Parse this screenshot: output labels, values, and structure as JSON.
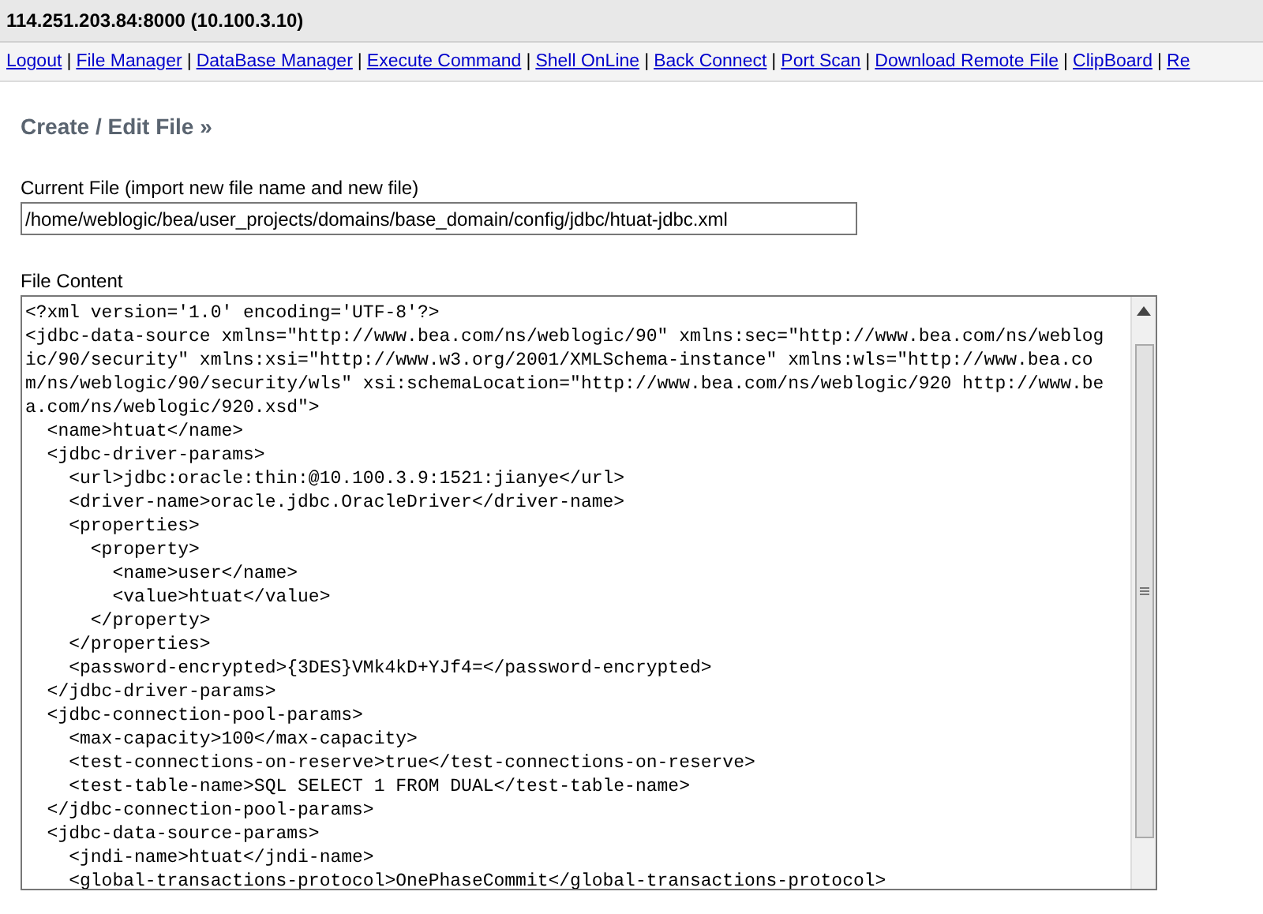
{
  "header": {
    "title": "114.251.203.84:8000 (10.100.3.10)"
  },
  "nav": {
    "separator": "|",
    "links": [
      "Logout",
      "File Manager",
      "DataBase Manager",
      "Execute Command",
      "Shell OnLine",
      "Back Connect",
      "Port Scan",
      "Download Remote File",
      "ClipBoard",
      "Re"
    ]
  },
  "section_title": "Create / Edit File »",
  "current_file": {
    "label": "Current File (import new file name and new file)",
    "value": "/home/weblogic/bea/user_projects/domains/base_domain/config/jdbc/htuat-jdbc.xml"
  },
  "file_content": {
    "label": "File Content",
    "lines": [
      "<?xml version='1.0' encoding='UTF-8'?>",
      "<jdbc-data-source xmlns=\"http://www.bea.com/ns/weblogic/90\" xmlns:sec=\"http://www.bea.com/ns/weblog",
      "ic/90/security\" xmlns:xsi=\"http://www.w3.org/2001/XMLSchema-instance\" xmlns:wls=\"http://www.bea.co",
      "m/ns/weblogic/90/security/wls\" xsi:schemaLocation=\"http://www.bea.com/ns/weblogic/920 http://www.be",
      "a.com/ns/weblogic/920.xsd\">",
      "  <name>htuat</name>",
      "  <jdbc-driver-params>",
      "    <url>jdbc:oracle:thin:@10.100.3.9:1521:jianye</url>",
      "    <driver-name>oracle.jdbc.OracleDriver</driver-name>",
      "    <properties>",
      "      <property>",
      "        <name>user</name>",
      "        <value>htuat</value>",
      "      </property>",
      "    </properties>",
      "    <password-encrypted>{3DES}VMk4kD+YJf4=</password-encrypted>",
      "  </jdbc-driver-params>",
      "  <jdbc-connection-pool-params>",
      "    <max-capacity>100</max-capacity>",
      "    <test-connections-on-reserve>true</test-connections-on-reserve>",
      "    <test-table-name>SQL SELECT 1 FROM DUAL</test-table-name>",
      "  </jdbc-connection-pool-params>",
      "  <jdbc-data-source-params>",
      "    <jndi-name>htuat</jndi-name>",
      "    <global-transactions-protocol>OnePhaseCommit</global-transactions-protocol>"
    ]
  }
}
